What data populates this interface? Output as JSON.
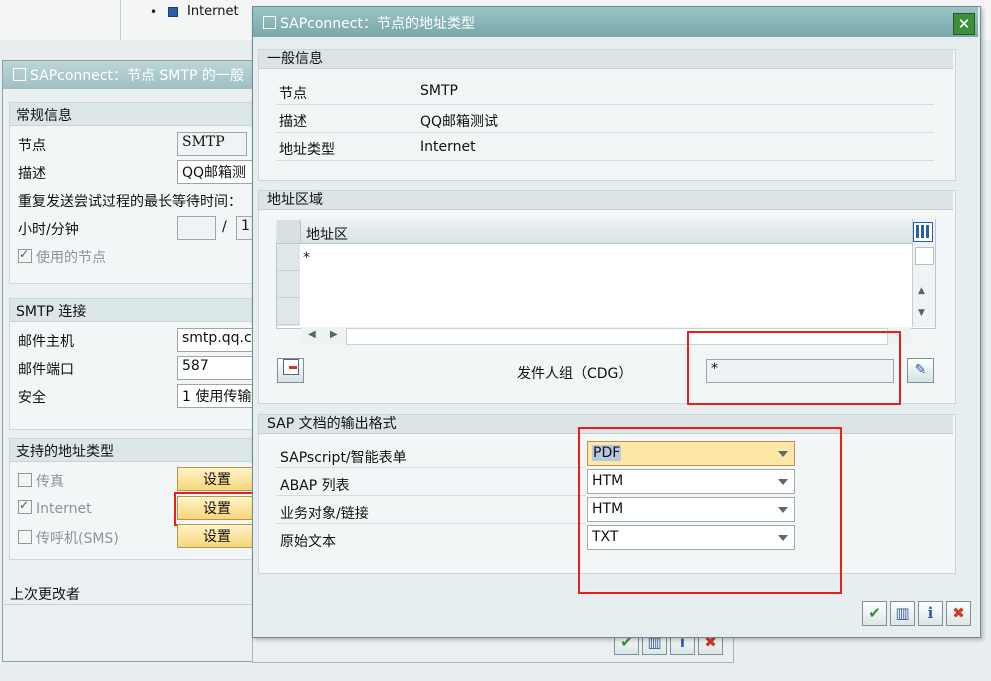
{
  "tree": {
    "item": "Internet"
  },
  "bg_dialog": {
    "title": "SAPconnect：节点 SMTP 的一般",
    "general": {
      "header": "常规信息",
      "node_label": "节点",
      "node_value": "SMTP",
      "desc_label": "描述",
      "desc_value": "QQ邮箱测",
      "retry_label": "重复发送尝试过程的最长等待时间：",
      "hours_label": "小时/分钟",
      "hours_sep": "/",
      "minutes_value": "1",
      "used_node_label": "使用的节点"
    },
    "smtp": {
      "header": "SMTP 连接",
      "host_label": "邮件主机",
      "host_value": "smtp.qq.co",
      "port_label": "邮件端口",
      "port_value": "587",
      "security_label": "安全",
      "security_value": "1 使用传输"
    },
    "types": {
      "header": "支持的地址类型",
      "fax_label": "传真",
      "internet_label": "Internet",
      "sms_label": "传呼机(SMS)",
      "set_label": "设置"
    },
    "last_changed_label": "上次更改者"
  },
  "dialog": {
    "title": "SAPconnect：节点的地址类型",
    "general": {
      "header": "一般信息",
      "node_label": "节点",
      "node_value": "SMTP",
      "desc_label": "描述",
      "desc_value": "QQ邮箱测试",
      "addr_type_label": "地址类型",
      "addr_type_value": "Internet"
    },
    "address_area": {
      "header": "地址区域",
      "column": "地址区",
      "rows": [
        "*",
        "",
        ""
      ],
      "sender_group_label": "发件人组（CDG）",
      "sender_group_value": "*"
    },
    "output_format": {
      "header": "SAP 文档的输出格式",
      "rows": [
        {
          "label": "SAPscript/智能表单",
          "value": "PDF"
        },
        {
          "label": "ABAP 列表",
          "value": "HTM"
        },
        {
          "label": "业务对象/链接",
          "value": "HTM"
        },
        {
          "label": "原始文本",
          "value": "TXT"
        }
      ]
    }
  },
  "colors": {
    "highlight": "#e8201a",
    "title_bar": "#79a7aa"
  }
}
